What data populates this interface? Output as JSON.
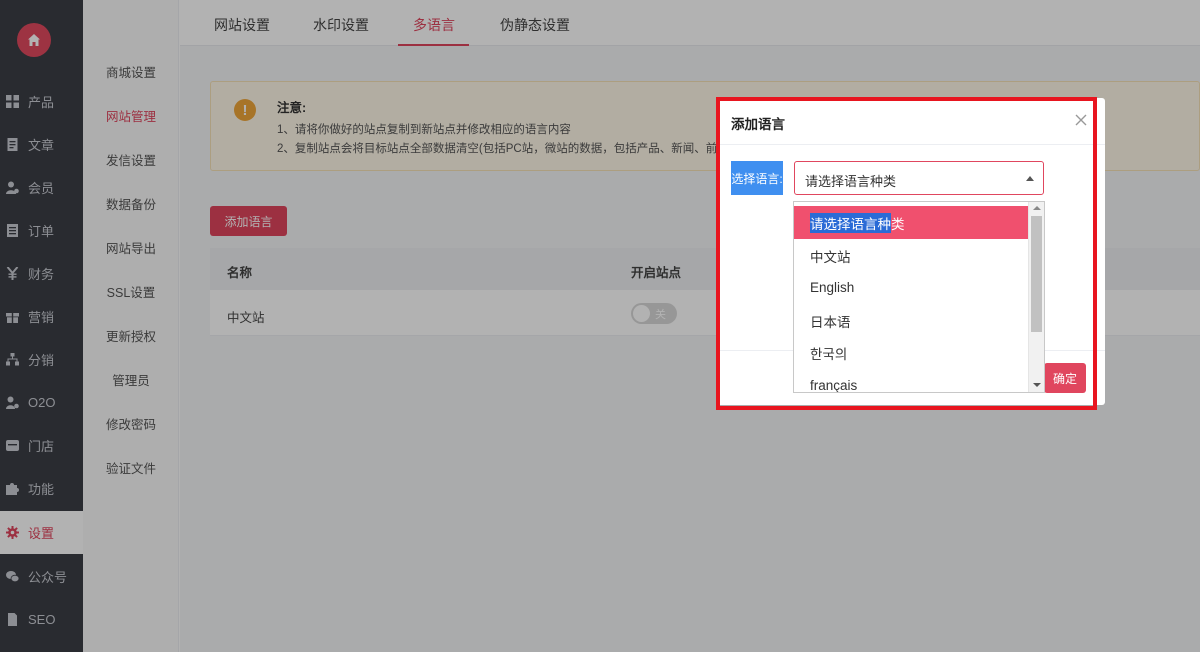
{
  "sidebar": {
    "items": [
      {
        "label": "产品",
        "icon": "grid-icon"
      },
      {
        "label": "文章",
        "icon": "document-icon"
      },
      {
        "label": "会员",
        "icon": "user-icon"
      },
      {
        "label": "订单",
        "icon": "order-icon"
      },
      {
        "label": "财务",
        "icon": "yen-icon"
      },
      {
        "label": "营销",
        "icon": "gift-icon"
      },
      {
        "label": "分销",
        "icon": "sitemap-icon"
      },
      {
        "label": "O2O",
        "icon": "user-group-icon"
      },
      {
        "label": "门店",
        "icon": "store-icon"
      },
      {
        "label": "功能",
        "icon": "puzzle-icon"
      },
      {
        "label": "设置",
        "icon": "gear-icon"
      },
      {
        "label": "公众号",
        "icon": "wechat-icon"
      },
      {
        "label": "SEO",
        "icon": "file-icon"
      }
    ],
    "active": "设置"
  },
  "subnav": {
    "items": [
      "商城设置",
      "网站管理",
      "发信设置",
      "数据备份",
      "网站导出",
      "SSL设置",
      "更新授权",
      "管理员",
      "修改密码",
      "验证文件"
    ],
    "active": "网站管理"
  },
  "tabs": {
    "items": [
      "网站设置",
      "水印设置",
      "多语言",
      "伪静态设置"
    ],
    "active": "多语言"
  },
  "notice": {
    "title": "注意:",
    "line1": "1、请将你做好的站点复制到新站点并修改相应的语言内容",
    "line2": "2、复制站点会将目标站点全部数据清空(包括PC站，微站的数据，包括产品、新闻、前"
  },
  "add_language_button": "添加语言",
  "table": {
    "headers": [
      "名称",
      "开启站点"
    ],
    "rows": [
      {
        "name": "中文站",
        "enabled": false,
        "toggle_label": "关"
      }
    ]
  },
  "dialog": {
    "title": "添加语言",
    "field_label": "选择语言:",
    "select_value": "请选择语言种类",
    "confirm_label": "确定",
    "options": [
      {
        "label_selected_part": "请选择语言种",
        "label_rest": "类",
        "selected": true
      },
      {
        "label": "中文站"
      },
      {
        "label": "English"
      },
      {
        "label": "日本语"
      },
      {
        "label": "한국의"
      },
      {
        "label": "français"
      }
    ]
  },
  "colors": {
    "accent": "#e0465e",
    "highlight_frame": "#e8151f",
    "sidebar_bg": "#3c3e45"
  }
}
